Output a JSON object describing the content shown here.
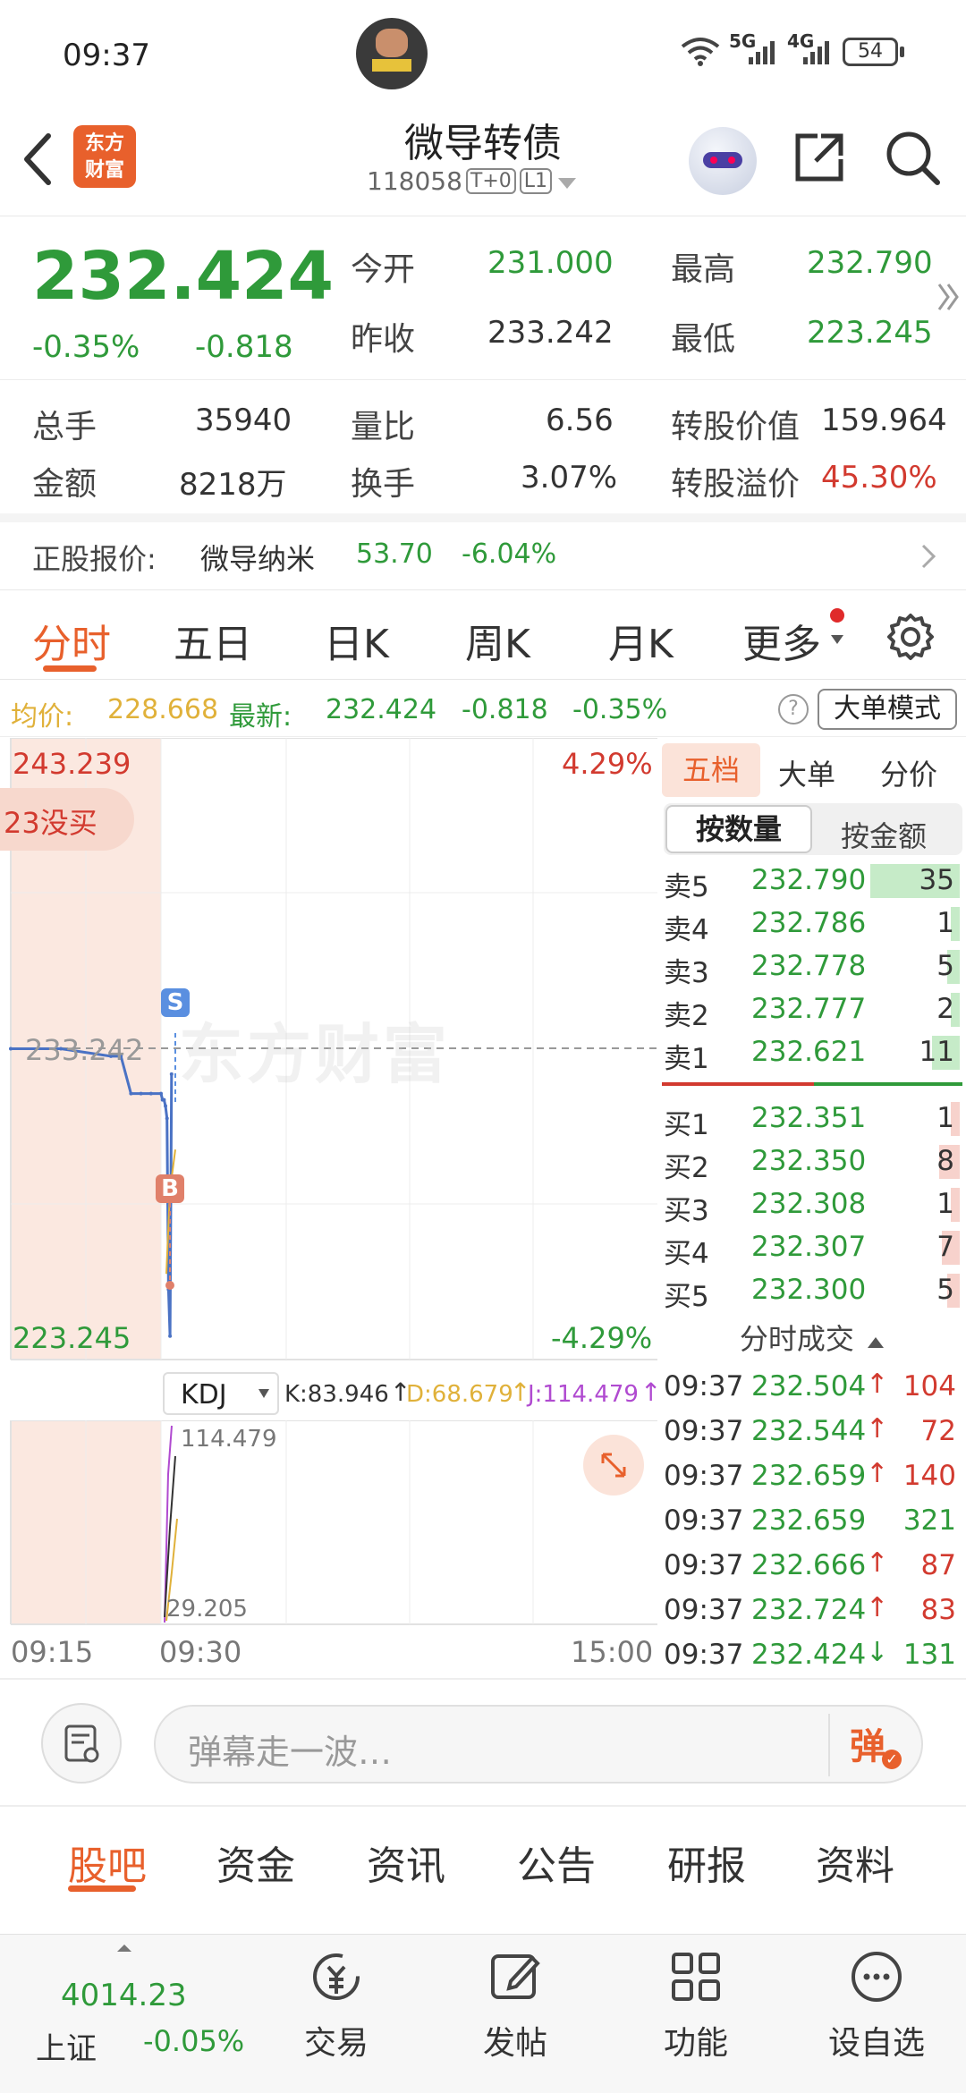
{
  "status_bar": {
    "time": "09:37",
    "network_a": "5G",
    "network_b": "4G",
    "battery": "54"
  },
  "header": {
    "title": "微导转债",
    "code": "118058",
    "badge_t0": "T+0",
    "badge_l1": "L1",
    "logo_text_line1": "东方",
    "logo_text_line2": "财富"
  },
  "quote": {
    "price": "232.424",
    "change_pct": "-0.35%",
    "change": "-0.818",
    "open_label": "今开",
    "open": "231.000",
    "high_label": "最高",
    "high": "232.790",
    "prev_close_label": "昨收",
    "prev_close": "233.242",
    "low_label": "最低",
    "low": "223.245",
    "volume_label": "总手",
    "volume": "35940",
    "vol_ratio_label": "量比",
    "vol_ratio": "6.56",
    "conv_value_label": "转股价值",
    "conv_value": "159.964",
    "amount_label": "金额",
    "amount": "8218万",
    "turnover_label": "换手",
    "turnover": "3.07%",
    "conv_premium_label": "转股溢价",
    "conv_premium": "45.30%"
  },
  "underlying": {
    "label": "正股报价:",
    "name": "微导纳米",
    "price": "53.70",
    "change_pct": "-6.04%"
  },
  "chart_tabs": [
    "分时",
    "五日",
    "日K",
    "周K",
    "月K",
    "更多"
  ],
  "active_tab": "分时",
  "info_line": {
    "avg_label": "均价:",
    "avg": "228.668",
    "latest_label": "最新:",
    "latest": "232.424",
    "change": "-0.818",
    "change_pct": "-0.35%",
    "mode_button": "大单模式"
  },
  "chart": {
    "top_price": "243.239",
    "top_pct": "4.29%",
    "mid_price": "233.242",
    "bottom_price": "223.245",
    "bottom_pct": "-4.29%",
    "toast": "23没买",
    "watermark": "东方财富",
    "marker_s": "S",
    "marker_b": "B",
    "indicator": "KDJ",
    "k_value": "K:83.946",
    "d_value": "D:68.679",
    "j_value": "J:114.479",
    "ind_top": "114.479",
    "ind_bottom": "29.205",
    "time_start": "09:15",
    "time_open": "09:30",
    "time_end": "15:00"
  },
  "chart_data": {
    "type": "line",
    "series": [
      {
        "x": [
          "09:15",
          "09:20",
          "09:25",
          "09:26",
          "09:27",
          "09:28",
          "09:29",
          "09:30",
          "09:31",
          "09:32",
          "09:33",
          "09:34",
          "09:35",
          "09:36",
          "09:37"
        ],
        "values": [
          233.242,
          233.242,
          233.0,
          233.0,
          231.8,
          231.8,
          231.8,
          231.8,
          231.6,
          231.6,
          231.4,
          231.0,
          225.5,
          224.0,
          232.424
        ]
      }
    ],
    "ylim": [
      223.245,
      243.239
    ]
  },
  "orderbook_tabs": [
    "五档",
    "大单",
    "分价"
  ],
  "orderbook_subtabs": [
    "按数量",
    "按金额"
  ],
  "orderbook": {
    "asks": [
      {
        "label": "卖5",
        "price": "232.790",
        "vol": "35"
      },
      {
        "label": "卖4",
        "price": "232.786",
        "vol": "1"
      },
      {
        "label": "卖3",
        "price": "232.778",
        "vol": "5"
      },
      {
        "label": "卖2",
        "price": "232.777",
        "vol": "2"
      },
      {
        "label": "卖1",
        "price": "232.621",
        "vol": "11"
      }
    ],
    "bids": [
      {
        "label": "买1",
        "price": "232.351",
        "vol": "1"
      },
      {
        "label": "买2",
        "price": "232.350",
        "vol": "8"
      },
      {
        "label": "买3",
        "price": "232.308",
        "vol": "1"
      },
      {
        "label": "买4",
        "price": "232.307",
        "vol": "7"
      },
      {
        "label": "买5",
        "price": "232.300",
        "vol": "5"
      }
    ]
  },
  "trades_title": "分时成交",
  "trades": [
    {
      "time": "09:37",
      "price": "232.504",
      "dir": "↑",
      "vol": "104"
    },
    {
      "time": "09:37",
      "price": "232.544",
      "dir": "↑",
      "vol": "72"
    },
    {
      "time": "09:37",
      "price": "232.659",
      "dir": "↑",
      "vol": "140"
    },
    {
      "time": "09:37",
      "price": "232.659",
      "dir": "",
      "vol": "321"
    },
    {
      "time": "09:37",
      "price": "232.666",
      "dir": "↑",
      "vol": "87"
    },
    {
      "time": "09:37",
      "price": "232.724",
      "dir": "↑",
      "vol": "83"
    },
    {
      "time": "09:37",
      "price": "232.424",
      "dir": "↓",
      "vol": "131"
    }
  ],
  "comment": {
    "placeholder": "弹幕走一波…",
    "danmu_button": "弹"
  },
  "bottom_tabs": [
    "股吧",
    "资金",
    "资讯",
    "公告",
    "研报",
    "资料"
  ],
  "bottom_nav": {
    "index_value": "4014.23",
    "index_name": "上证",
    "index_change": "-0.05%",
    "items": [
      "交易",
      "发帖",
      "功能",
      "设自选"
    ]
  },
  "colors": {
    "up": "#d23a2f",
    "down": "#2f9a3a",
    "accent": "#e8602c",
    "avg_line": "#e0b13a",
    "price_line": "#4a72c4"
  }
}
